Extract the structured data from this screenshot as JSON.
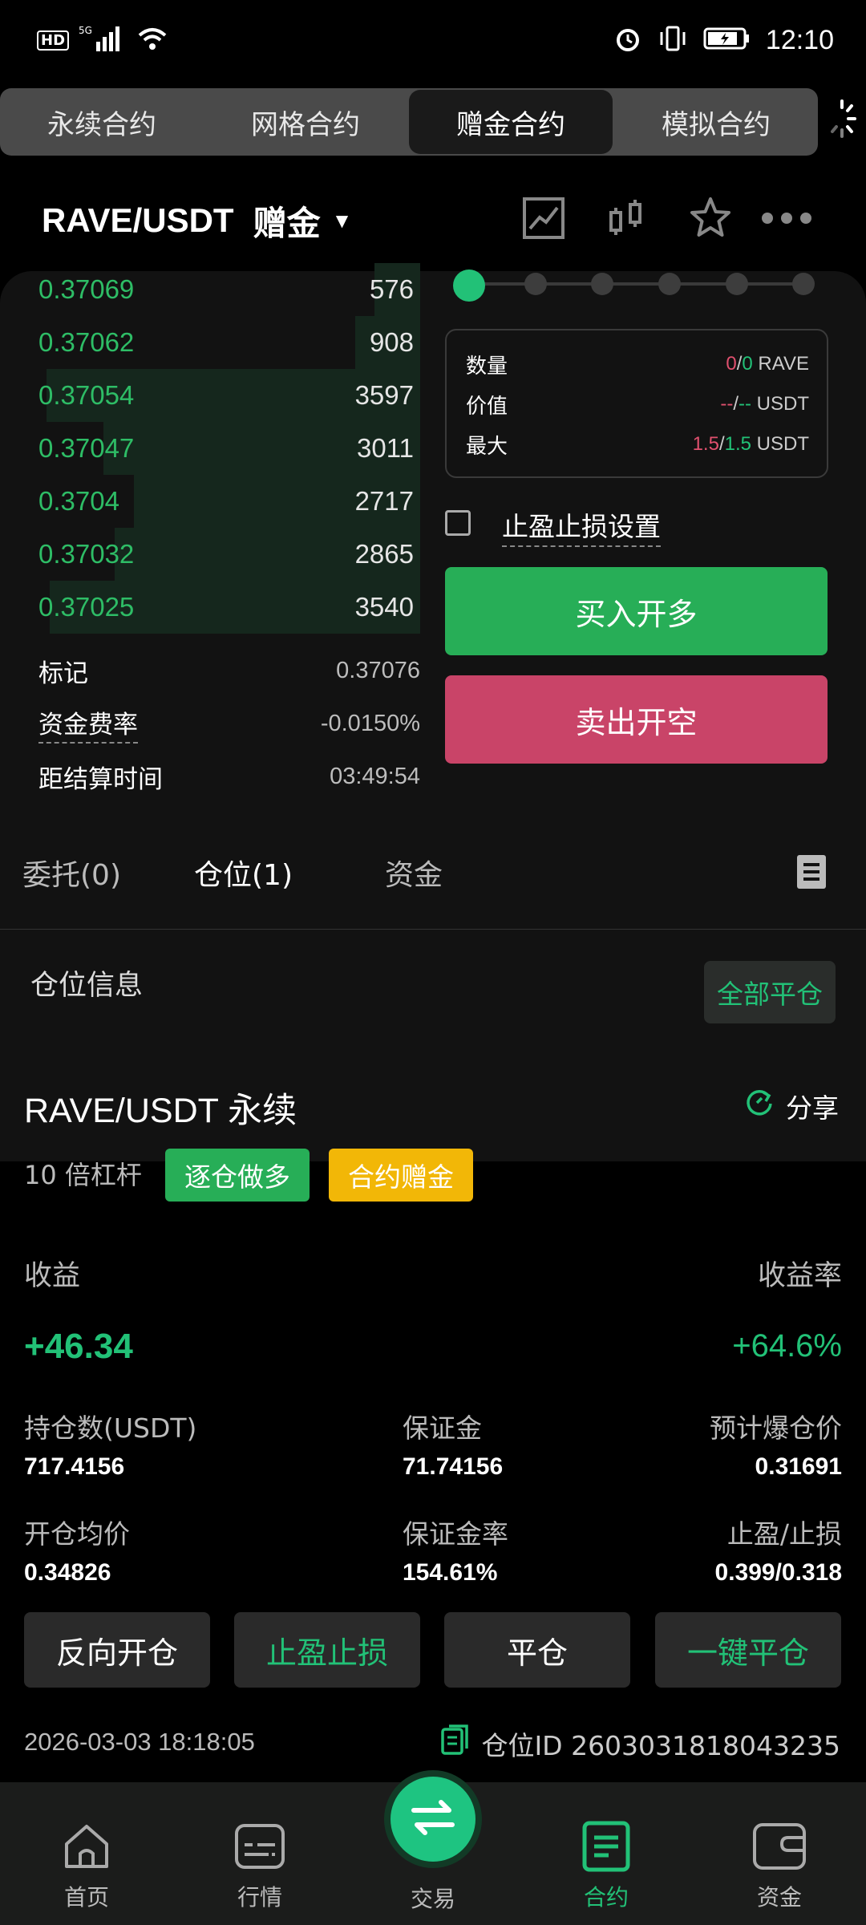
{
  "status": {
    "time": "12:10",
    "network": "HD",
    "signal": "5G"
  },
  "tabs": [
    {
      "label": "永续合约"
    },
    {
      "label": "网格合约"
    },
    {
      "label": "赠金合约"
    },
    {
      "label": "模拟合约"
    }
  ],
  "pair": {
    "symbol": "RAVE/USDT",
    "mode": "赠金"
  },
  "orderbook": [
    {
      "price": "0.37069",
      "qty": "576",
      "depth": 0.12
    },
    {
      "price": "0.37062",
      "qty": "908",
      "depth": 0.17
    },
    {
      "price": "0.37054",
      "qty": "3597",
      "depth": 0.98
    },
    {
      "price": "0.37047",
      "qty": "3011",
      "depth": 0.83
    },
    {
      "price": "0.3704",
      "qty": "2717",
      "depth": 0.75
    },
    {
      "price": "0.37032",
      "qty": "2865",
      "depth": 0.8
    },
    {
      "price": "0.37025",
      "qty": "3540",
      "depth": 0.97
    }
  ],
  "market": {
    "mark_label": "标记",
    "mark_value": "0.37076",
    "funding_label": "资金费率",
    "funding_value": "-0.0150%",
    "settle_label": "距结算时间",
    "settle_value": "03:49:54"
  },
  "order_form": {
    "qty_label": "数量",
    "qty_a": "0",
    "qty_b": "0",
    "qty_unit": "RAVE",
    "value_label": "价值",
    "value_a": "--",
    "value_b": "--",
    "value_unit": "USDT",
    "max_label": "最大",
    "max_a": "1.5",
    "max_b": "1.5",
    "max_unit": "USDT",
    "tpsl_label": "止盈止损设置",
    "buy_label": "买入开多",
    "sell_label": "卖出开空",
    "slider_level": 0
  },
  "subtabs": [
    {
      "label": "委托(0)"
    },
    {
      "label": "仓位(1)"
    },
    {
      "label": "资金"
    }
  ],
  "positions": {
    "section_title": "仓位信息",
    "close_all": "全部平仓",
    "title": "RAVE/USDT 永续",
    "share": "分享",
    "leverage": "10 倍杠杆",
    "tag_side": "逐仓做多",
    "tag_bonus": "合约赠金",
    "pnl_label": "收益",
    "pnl_value": "+46.34",
    "roi_label": "收益率",
    "roi_value": "+64.6%",
    "size_label": "持仓数(USDT)",
    "size_value": "717.4156",
    "margin_label": "保证金",
    "margin_value": "71.74156",
    "liq_label": "预计爆仓价",
    "liq_value": "0.31691",
    "entry_label": "开仓均价",
    "entry_value": "0.34826",
    "mrate_label": "保证金率",
    "mrate_value": "154.61%",
    "tpsl_label": "止盈/止损",
    "tpsl_value": "0.399/0.318",
    "btn_reverse": "反向开仓",
    "btn_tpsl": "止盈止损",
    "btn_close": "平仓",
    "btn_quick": "一键平仓",
    "timestamp": "2026-03-03 18:18:05",
    "pos_id": "仓位ID 2603031818043235"
  },
  "nav": [
    {
      "label": "首页"
    },
    {
      "label": "行情"
    },
    {
      "label": "交易"
    },
    {
      "label": "合约"
    },
    {
      "label": "资金"
    }
  ],
  "colors": {
    "green": "#22c177",
    "red": "#e0506e",
    "buy": "#27ae57",
    "sell": "#c94468",
    "bonus": "#f2b707"
  }
}
